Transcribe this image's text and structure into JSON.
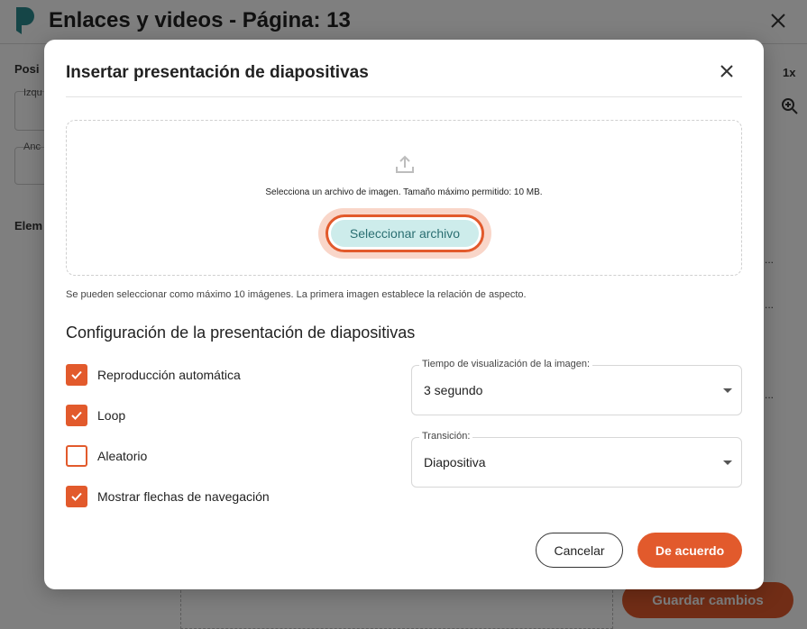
{
  "app": {
    "title": "Enlaces y videos - Página: 13",
    "bg_labels": {
      "position": "Posi",
      "left": "Izqu",
      "width": "Anc",
      "elements": "Elem"
    },
    "bg_zoom": "1x",
    "bg_dots": "...",
    "save_label": "Guardar cambios"
  },
  "modal": {
    "title": "Insertar presentación de diapositivas",
    "dropzone_hint": "Selecciona un archivo de imagen. Tamaño máximo permitido: 10 MB.",
    "select_button_label": "Seleccionar archivo",
    "limit_note": "Se pueden seleccionar como máximo 10 imágenes. La primera imagen establece la relación de aspecto.",
    "section_title": "Configuración de la presentación de diapositivas",
    "options": [
      {
        "label": "Reproducción automática",
        "checked": true
      },
      {
        "label": "Loop",
        "checked": true
      },
      {
        "label": "Aleatorio",
        "checked": false
      },
      {
        "label": "Mostrar flechas de navegación",
        "checked": true
      }
    ],
    "display_time": {
      "legend": "Tiempo de visualización de la imagen:",
      "value": "3 segundo"
    },
    "transition": {
      "legend": "Transición:",
      "value": "Diapositiva"
    },
    "cancel_label": "Cancelar",
    "ok_label": "De acuerdo"
  },
  "colors": {
    "accent": "#e25a2c",
    "button_fill": "#cdeceb",
    "button_text": "#2b6f72",
    "logo": "#2b8a8f"
  },
  "icons": [
    "app-logo-icon",
    "close-icon",
    "upload-icon",
    "checkmark-icon",
    "zoom-in-icon",
    "chevron-down-icon"
  ]
}
